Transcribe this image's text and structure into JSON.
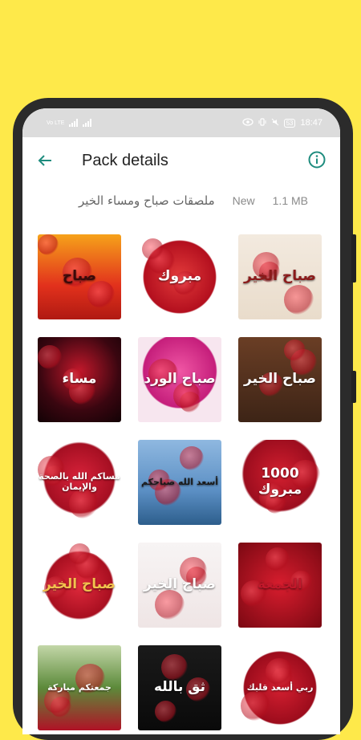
{
  "status_bar": {
    "network_label": "Vo LTE",
    "battery": "53",
    "time": "18:47"
  },
  "app_bar": {
    "title": "Pack details",
    "back_icon": "arrow-left-icon",
    "info_icon": "info-icon",
    "accent_color": "#1E8C7E"
  },
  "pack": {
    "name": "ملصقات صباح ومساء الخير",
    "status": "New",
    "size": "1.1 MB"
  },
  "stickers": [
    {
      "text": "صباح",
      "bg": "linear-gradient(#f6a21a,#e2311c 60%,#b01a12)",
      "color": "#3a0a0a"
    },
    {
      "text": "مبروك",
      "bg": "radial-gradient(circle at 50% 50%,#e23a3a,#b30f1e 60%,#fff 62%)",
      "color": "#fff"
    },
    {
      "text": "صباح الخير",
      "bg": "linear-gradient(#f3eadf,#e9dccb)",
      "color": "#8b1a1a"
    },
    {
      "text": "مساء",
      "bg": "radial-gradient(circle at 50% 40%,#c2182b,#3a0610 60%,#120205)",
      "color": "#fff"
    },
    {
      "text": "صباح الورد",
      "bg": "radial-gradient(circle at 50% 40%,#f056a4,#c51e7b 55%,#f7e6ef 57%)",
      "color": "#fff"
    },
    {
      "text": "صباح الخير",
      "bg": "linear-gradient(#6a3e25,#3d2416)",
      "color": "#fff"
    },
    {
      "text": "مساكم الله بالصحة والإيمان",
      "bg": "radial-gradient(circle at 50% 45%,#d8223a,#a50f22 55%,#ffffff 58%)",
      "color": "#fff"
    },
    {
      "text": "أسعد الله صباحكم",
      "bg": "linear-gradient(#8fb8e0,#5b8fc4 60%,#2d5e8c)",
      "color": "#1a1a1a"
    },
    {
      "text": "1000 مبروك",
      "bg": "radial-gradient(circle at 50% 40%,#d21f2f,#9c0d1e 55%,#ffffff 58%)",
      "color": "#fff"
    },
    {
      "text": "صباح الخير",
      "bg": "radial-gradient(circle at 50% 50%,#e02a3c,#a80f20 55%,#ffffff 58%)",
      "color": "#f3c24e"
    },
    {
      "text": "صباح الخير",
      "bg": "linear-gradient(#f7f4f4,#efe5e5)",
      "color": "#fff"
    },
    {
      "text": "الجمعة",
      "bg": "radial-gradient(circle at 50% 50%,#d81d2e,#7a0812)",
      "color": "#c2182b"
    },
    {
      "text": "جمعتكم مباركة",
      "bg": "linear-gradient(#c3d7a8,#5c8a3a 50%,#b01226)",
      "color": "#fff"
    },
    {
      "text": "ثق بالله",
      "bg": "linear-gradient(#1a1a1a,#0a0a0a)",
      "color": "#fff"
    },
    {
      "text": "ربي أسعد قلبك",
      "bg": "radial-gradient(circle at 50% 50%,#d31f30,#9c0c1c 60%,#fff 62%)",
      "color": "#fff"
    }
  ]
}
